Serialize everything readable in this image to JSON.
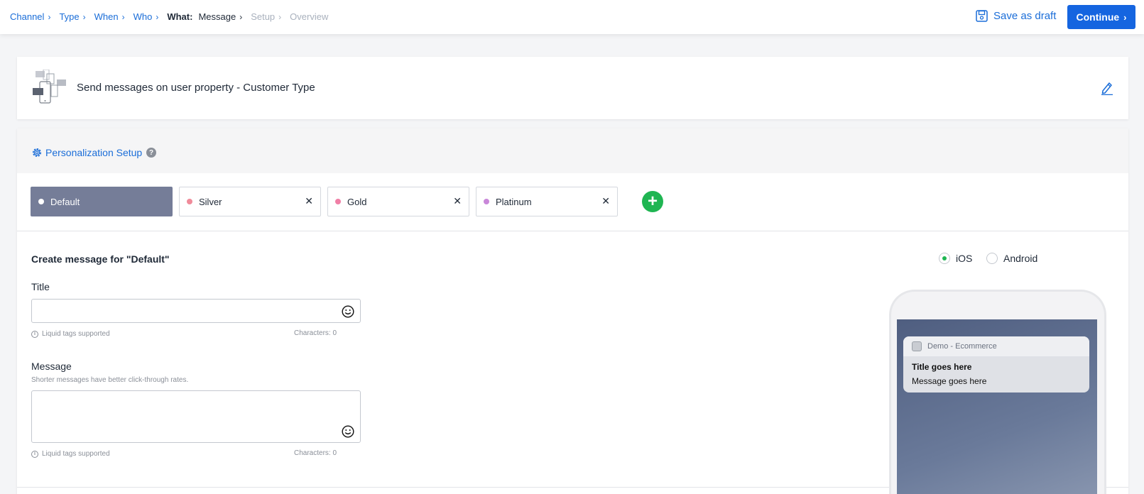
{
  "breadcrumb": {
    "steps": [
      {
        "label": "Channel",
        "state": "done"
      },
      {
        "label": "Type",
        "state": "done"
      },
      {
        "label": "When",
        "state": "done"
      },
      {
        "label": "Who",
        "state": "done"
      },
      {
        "prefix": "What:",
        "label": "Message",
        "state": "current"
      },
      {
        "label": "Setup",
        "state": "disabled"
      },
      {
        "label": "Overview",
        "state": "disabled"
      }
    ]
  },
  "header": {
    "save_draft_label": "Save as draft",
    "continue_label": "Continue"
  },
  "campaign": {
    "title": "Send messages on user property - Customer Type"
  },
  "personalization": {
    "title": "Personalization Setup",
    "help": "?",
    "variations": [
      {
        "label": "Default",
        "dot_color": "#ffffff",
        "active": true
      },
      {
        "label": "Silver",
        "dot_color": "#f08b9a",
        "active": false
      },
      {
        "label": "Gold",
        "dot_color": "#f07fa6",
        "active": false
      },
      {
        "label": "Platinum",
        "dot_color": "#c987d9",
        "active": false
      }
    ],
    "add_label": "+"
  },
  "form": {
    "heading": "Create message for \"Default\"",
    "title_label": "Title",
    "title_value": "",
    "title_liquid": "Liquid tags supported",
    "title_chars": "Characters: 0",
    "message_label": "Message",
    "message_hint": "Shorter messages have better click-through rates.",
    "message_value": "",
    "message_liquid": "Liquid tags supported",
    "message_chars": "Characters: 0"
  },
  "platforms": {
    "ios": "iOS",
    "android": "Android",
    "selected": "iOS"
  },
  "preview": {
    "app_name": "Demo - Ecommerce",
    "title": "Title goes here",
    "message": "Message goes here"
  },
  "colors": {
    "accent": "#1a6dd8",
    "primary_button": "#1565e0",
    "active_tab": "#757d98",
    "add_button": "#1fb552"
  }
}
